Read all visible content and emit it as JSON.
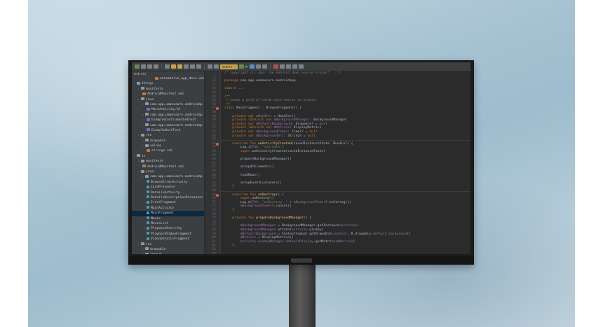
{
  "colors": {
    "ide_bg": "#2b2b2b",
    "sidebar_bg": "#3c3f41",
    "keyword": "#cc7832",
    "string": "#6a8759",
    "function": "#ffc66d",
    "field": "#9876aa",
    "comment": "#808080"
  },
  "toolbar": {
    "module_label": "module ▾",
    "icons": [
      "open-icon",
      "save-icon",
      "sync-icon",
      "undo-icon",
      "redo-icon",
      "cut-icon",
      "copy-icon",
      "paste-icon",
      "find-icon",
      "replace-icon",
      "back-icon",
      "forward-icon",
      "build-icon",
      "run-icon",
      "debug-icon",
      "profile-icon",
      "attach-icon",
      "stop-icon",
      "avd-icon",
      "sdk-icon",
      "structure-icon",
      "help-icon"
    ]
  },
  "project": {
    "header": "Android",
    "tree": [
      {
        "label": "automotive_app_desc.xml",
        "depth": 5,
        "kind": "file-x"
      },
      {
        "label": "things",
        "depth": 0,
        "kind": "folder"
      },
      {
        "label": "manifests",
        "depth": 1,
        "kind": "folder"
      },
      {
        "label": "AndroidManifest.xml",
        "depth": 2,
        "kind": "file-x"
      },
      {
        "label": "java",
        "depth": 1,
        "kind": "folder"
      },
      {
        "label": "com.app.umanusorn.androidap",
        "depth": 2,
        "kind": "folder"
      },
      {
        "label": "MainActivity.kt",
        "depth": 3,
        "kind": "file-k"
      },
      {
        "label": "com.app.umanusorn.androidap",
        "depth": 2,
        "kind": "folder"
      },
      {
        "label": "ExampleInstrumentedTest",
        "depth": 3,
        "kind": "file-k"
      },
      {
        "label": "com.app.umanusorn.androidap",
        "depth": 2,
        "kind": "folder"
      },
      {
        "label": "ExampleUnitTest",
        "depth": 3,
        "kind": "file-k"
      },
      {
        "label": "res",
        "depth": 1,
        "kind": "folder"
      },
      {
        "label": "drawable",
        "depth": 2,
        "kind": "folder"
      },
      {
        "label": "values",
        "depth": 2,
        "kind": "folder"
      },
      {
        "label": "strings.xml",
        "depth": 3,
        "kind": "file-x"
      },
      {
        "label": "tv",
        "depth": 0,
        "kind": "folder"
      },
      {
        "label": "manifests",
        "depth": 1,
        "kind": "folder"
      },
      {
        "label": "AndroidManifest.xml",
        "depth": 2,
        "kind": "file-x"
      },
      {
        "label": "java",
        "depth": 1,
        "kind": "folder"
      },
      {
        "label": "com.app.umanusorn.androidap",
        "depth": 2,
        "kind": "folder"
      },
      {
        "label": "BrowseErrorActivity",
        "depth": 3,
        "kind": "file-c"
      },
      {
        "label": "CardPresenter",
        "depth": 3,
        "kind": "file-c"
      },
      {
        "label": "DetailsActivity",
        "depth": 3,
        "kind": "file-c"
      },
      {
        "label": "DetailsDescriptionPresenter",
        "depth": 3,
        "kind": "file-c"
      },
      {
        "label": "ErrorFragment",
        "depth": 3,
        "kind": "file-c"
      },
      {
        "label": "MainActivity",
        "depth": 3,
        "kind": "file-c"
      },
      {
        "label": "MainFragment",
        "depth": 3,
        "kind": "file-c",
        "selected": true
      },
      {
        "label": "Movie",
        "depth": 3,
        "kind": "file-c"
      },
      {
        "label": "MovieList",
        "depth": 3,
        "kind": "file-c"
      },
      {
        "label": "PlaybackActivity",
        "depth": 3,
        "kind": "file-c"
      },
      {
        "label": "PlaybackVideoFragment",
        "depth": 3,
        "kind": "file-c"
      },
      {
        "label": "VideoDetailsFragment",
        "depth": 3,
        "kind": "file-c"
      },
      {
        "label": "res",
        "depth": 1,
        "kind": "folder"
      },
      {
        "label": "drawable",
        "depth": 2,
        "kind": "folder"
      },
      {
        "label": "layout",
        "depth": 2,
        "kind": "folder"
      },
      {
        "label": "mipmap",
        "depth": 2,
        "kind": "folder"
      }
    ]
  },
  "editor": {
    "lines": [
      {
        "n": "1",
        "parts": [
          [
            "cm",
            "/* Copyright (C) 2017 The Android Open Source Project ...*/"
          ]
        ]
      },
      {
        "n": "2",
        "parts": []
      },
      {
        "n": "16",
        "parts": [
          [
            "kw",
            "package "
          ],
          [
            "tx",
            "com.app.umanusorn.androidapp"
          ]
        ]
      },
      {
        "n": "17",
        "parts": []
      },
      {
        "n": "18",
        "parts": [
          [
            "kw",
            "import "
          ],
          [
            "tx",
            "..."
          ]
        ]
      },
      {
        "n": "19",
        "parts": []
      },
      {
        "n": "44",
        "parts": [
          [
            "cm",
            "/**"
          ]
        ]
      },
      {
        "n": "45",
        "parts": [
          [
            "cm",
            " * Loads a grid of cards with movies to browse."
          ]
        ]
      },
      {
        "n": "46",
        "parts": [
          [
            "cm",
            " */"
          ]
        ]
      },
      {
        "n": "47",
        "mark": "o",
        "parts": [
          [
            "kw",
            "class "
          ],
          [
            "tx",
            "MainFragment : BrowseFragment() {"
          ]
        ]
      },
      {
        "n": "48",
        "parts": []
      },
      {
        "n": "49",
        "parts": [
          [
            "kw",
            "    private val "
          ],
          [
            "fd",
            "mHandler"
          ],
          [
            "tx",
            " = Handler()"
          ]
        ]
      },
      {
        "n": "50",
        "parts": [
          [
            "kw",
            "    private lateinit var "
          ],
          [
            "fd",
            "mBackgroundManager"
          ],
          [
            "tx",
            ": BackgroundManager"
          ]
        ]
      },
      {
        "n": "51",
        "parts": [
          [
            "kw",
            "    private var "
          ],
          [
            "fd",
            "mDefaultBackground"
          ],
          [
            "tx",
            ": Drawable? = "
          ],
          [
            "kw",
            "null"
          ]
        ]
      },
      {
        "n": "52",
        "parts": [
          [
            "kw",
            "    private lateinit var "
          ],
          [
            "fd",
            "mMetrics"
          ],
          [
            "tx",
            ": DisplayMetrics"
          ]
        ]
      },
      {
        "n": "53",
        "parts": [
          [
            "kw",
            "    private var "
          ],
          [
            "fd",
            "mBackgroundTimer"
          ],
          [
            "tx",
            ": Timer? = "
          ],
          [
            "kw",
            "null"
          ]
        ]
      },
      {
        "n": "54",
        "parts": [
          [
            "kw",
            "    private var "
          ],
          [
            "fd",
            "mBackgroundUri"
          ],
          [
            "tx",
            ": String? = "
          ],
          [
            "kw",
            "null"
          ]
        ]
      },
      {
        "n": "55",
        "parts": []
      },
      {
        "n": "56",
        "mark": "o",
        "parts": [
          [
            "kw",
            "    override fun "
          ],
          [
            "fn",
            "onActivityCreated"
          ],
          [
            "tx",
            "(savedInstanceState: Bundle?) {"
          ]
        ]
      },
      {
        "n": "57",
        "parts": [
          [
            "tx",
            "        Log.i("
          ],
          [
            "fd",
            "TAG"
          ],
          [
            "tx",
            ", "
          ],
          [
            "st",
            "\"onCreate\""
          ],
          [
            "tx",
            ")"
          ]
        ]
      },
      {
        "n": "58",
        "parts": [
          [
            "kw",
            "        super"
          ],
          [
            "tx",
            ".onActivityCreated(savedInstanceState)"
          ]
        ]
      },
      {
        "n": "59",
        "parts": []
      },
      {
        "n": "60",
        "parts": [
          [
            "tx",
            "        prepareBackgroundManager()"
          ]
        ]
      },
      {
        "n": "61",
        "parts": []
      },
      {
        "n": "62",
        "parts": [
          [
            "tx",
            "        setupUIElements()"
          ]
        ]
      },
      {
        "n": "63",
        "parts": []
      },
      {
        "n": "64",
        "parts": [
          [
            "tx",
            "        loadRows()"
          ]
        ]
      },
      {
        "n": "65",
        "parts": []
      },
      {
        "n": "66",
        "parts": [
          [
            "tx",
            "        setupEventListeners()"
          ]
        ]
      },
      {
        "n": "67",
        "parts": [
          [
            "tx",
            "    }"
          ]
        ]
      },
      {
        "n": "68",
        "parts": []
      },
      {
        "n": "69",
        "mark": "o",
        "parts": [
          [
            "kw",
            "    override fun "
          ],
          [
            "fn",
            "onDestroy"
          ],
          [
            "tx",
            "() {"
          ]
        ]
      },
      {
        "n": "70",
        "parts": [
          [
            "kw",
            "        super"
          ],
          [
            "tx",
            ".onDestroy()"
          ]
        ]
      },
      {
        "n": "71",
        "parts": [
          [
            "tx",
            "        Log.d("
          ],
          [
            "fd",
            "TAG"
          ],
          [
            "tx",
            ", "
          ],
          [
            "st",
            "\"onDestroy: \""
          ],
          [
            "tx",
            " + "
          ],
          [
            "fd",
            "mBackgroundTimer"
          ],
          [
            "tx",
            "?.toString())"
          ]
        ]
      },
      {
        "n": "72",
        "parts": [
          [
            "fd",
            "        mBackgroundTimer"
          ],
          [
            "tx",
            "?.cancel()"
          ]
        ]
      },
      {
        "n": "73",
        "parts": [
          [
            "tx",
            "    }"
          ]
        ]
      },
      {
        "n": "74",
        "parts": []
      },
      {
        "n": "75",
        "parts": [
          [
            "kw",
            "    private fun "
          ],
          [
            "fn",
            "prepareBackgroundManager"
          ],
          [
            "tx",
            "() {"
          ]
        ]
      },
      {
        "n": "76",
        "parts": []
      },
      {
        "n": "77",
        "parts": [
          [
            "fd",
            "        mBackgroundManager"
          ],
          [
            "tx",
            " = BackgroundManager.getInstance("
          ],
          [
            "fd",
            "activity"
          ],
          [
            "tx",
            ")"
          ]
        ]
      },
      {
        "n": "78",
        "parts": [
          [
            "fd",
            "        mBackgroundManager"
          ],
          [
            "tx",
            ".attach("
          ],
          [
            "fd",
            "activity"
          ],
          [
            "tx",
            ".window)"
          ]
        ]
      },
      {
        "n": "79",
        "parts": [
          [
            "fd",
            "        mDefaultBackground"
          ],
          [
            "tx",
            " = ContextCompat.getDrawable("
          ],
          [
            "fd",
            "context"
          ],
          [
            "tx",
            ", R.drawable."
          ],
          [
            "fd",
            "default_background"
          ],
          [
            "tx",
            ")"
          ]
        ]
      },
      {
        "n": "80",
        "parts": [
          [
            "fd",
            "        mMetrics"
          ],
          [
            "tx",
            " = DisplayMetrics()"
          ]
        ]
      },
      {
        "n": "81",
        "parts": [
          [
            "fd",
            "        activity"
          ],
          [
            "tx",
            "."
          ],
          [
            "fd",
            "windowManager"
          ],
          [
            "tx",
            "."
          ],
          [
            "fd",
            "defaultDisplay"
          ],
          [
            "tx",
            ".getMetrics("
          ],
          [
            "fd",
            "mMetrics"
          ],
          [
            "tx",
            ")"
          ]
        ]
      },
      {
        "n": "82",
        "parts": [
          [
            "tx",
            "    }"
          ]
        ]
      },
      {
        "n": "83",
        "parts": []
      },
      {
        "n": "84",
        "parts": []
      },
      {
        "n": "85",
        "parts": []
      }
    ]
  }
}
